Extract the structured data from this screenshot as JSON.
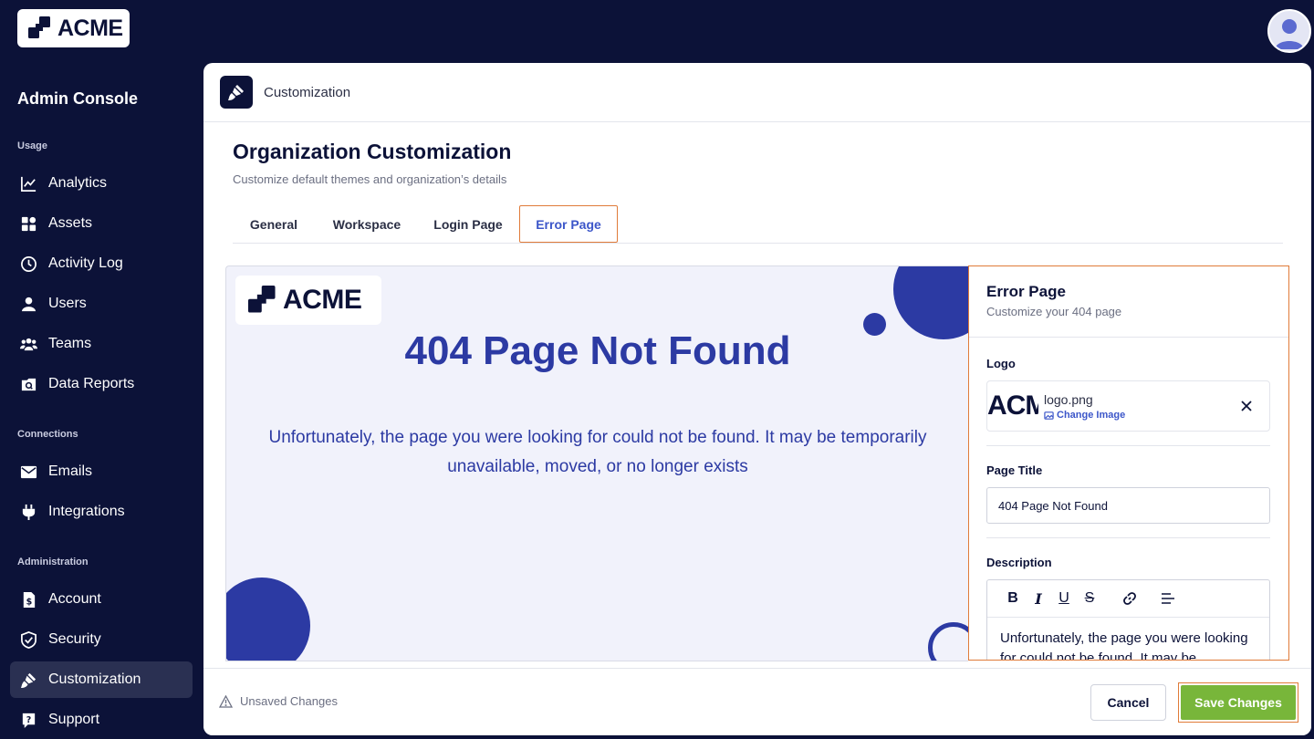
{
  "brand": {
    "name": "ACME",
    "color": "#0c1238"
  },
  "sidebar": {
    "title": "Admin Console",
    "sections": {
      "usage": "Usage",
      "connections": "Connections",
      "administration": "Administration"
    },
    "items": [
      {
        "label": "Analytics",
        "icon": "chart-line-icon"
      },
      {
        "label": "Assets",
        "icon": "grid-icon"
      },
      {
        "label": "Activity Log",
        "icon": "history-icon"
      },
      {
        "label": "Users",
        "icon": "user-icon"
      },
      {
        "label": "Teams",
        "icon": "team-icon"
      },
      {
        "label": "Data Reports",
        "icon": "report-icon"
      },
      {
        "label": "Emails",
        "icon": "mail-icon"
      },
      {
        "label": "Integrations",
        "icon": "plug-icon"
      },
      {
        "label": "Account",
        "icon": "account-icon"
      },
      {
        "label": "Security",
        "icon": "shield-icon"
      },
      {
        "label": "Customization",
        "icon": "brush-icon",
        "active": true
      },
      {
        "label": "Support",
        "icon": "support-icon"
      }
    ]
  },
  "header": {
    "title": "Customization"
  },
  "page": {
    "title": "Organization Customization",
    "subtitle": "Customize default themes and organization’s details"
  },
  "tabs": [
    {
      "label": "General"
    },
    {
      "label": "Workspace"
    },
    {
      "label": "Login Page"
    },
    {
      "label": "Error Page",
      "active": true
    }
  ],
  "preview": {
    "logo_text": "ACME",
    "title": "404 Page Not Found",
    "description": "Unfortunately, the page you were looking for could not be found. It may be temporarily unavailable, moved, or no longer exists",
    "accent": "#2c3aa3",
    "background": "#f1f2fb"
  },
  "settings": {
    "title": "Error Page",
    "subtitle": "Customize your 404 page",
    "logo_label": "Logo",
    "logo_thumb_text": "ACME",
    "logo_filename": "logo.png",
    "logo_change": "Change Image",
    "page_title_label": "Page Title",
    "page_title_value": "404 Page Not Found",
    "description_label": "Description",
    "toolbar": [
      "B",
      "I",
      "U",
      "S"
    ],
    "description_value": "Unfortunately, the page you were looking for could not be found. It may be temporarily unavailable, moved, or no longer exists"
  },
  "footer": {
    "unsaved": "Unsaved Changes",
    "cancel": "Cancel",
    "save": "Save Changes",
    "save_color": "#78b63a"
  }
}
